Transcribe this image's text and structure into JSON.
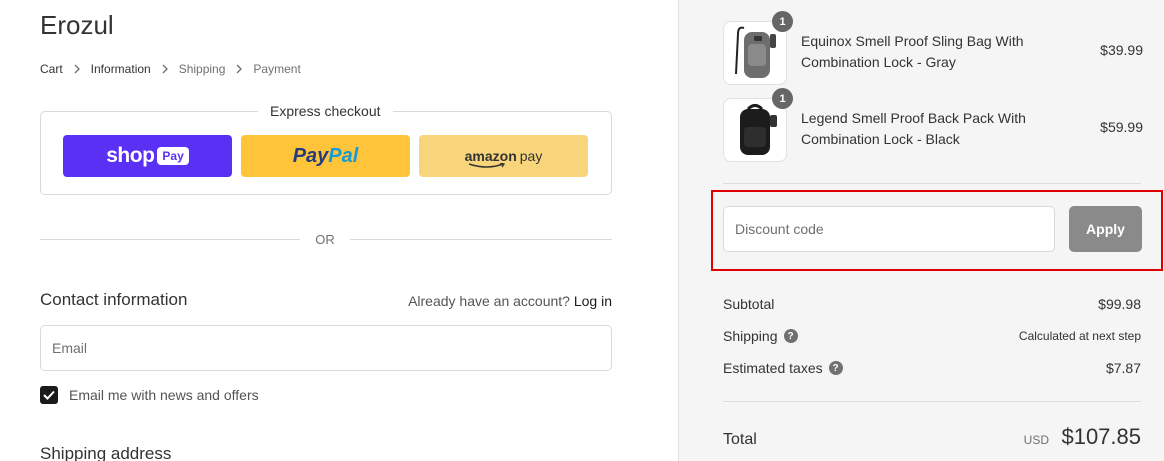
{
  "store": {
    "name": "Erozul"
  },
  "breadcrumb": [
    {
      "label": "Cart"
    },
    {
      "label": "Information"
    },
    {
      "label": "Shipping"
    },
    {
      "label": "Payment"
    }
  ],
  "express": {
    "legend": "Express checkout",
    "shop_pay": {
      "shop": "shop",
      "pay": "Pay",
      "color": "#5a31f4"
    },
    "paypal": {
      "part1": "Pay",
      "part2": "Pal",
      "color": "#ffc439"
    },
    "amazon": {
      "brand": "amazon",
      "pay": "pay",
      "color": "#f8d57a"
    }
  },
  "divider_text": "OR",
  "contact": {
    "heading": "Contact information",
    "account_prompt": "Already have an account?",
    "login_label": "Log in",
    "email_placeholder": "Email",
    "newsletter_label": "Email me with news and offers",
    "newsletter_checked": true
  },
  "shipping": {
    "heading": "Shipping address"
  },
  "cart": {
    "items": [
      {
        "quantity": "1",
        "name": "Equinox Smell Proof Sling Bag With Combination Lock - Gray",
        "price": "$39.99",
        "icon": "sling-bag-gray-icon"
      },
      {
        "quantity": "1",
        "name": "Legend Smell Proof Back Pack With Combination Lock - Black",
        "price": "$59.99",
        "icon": "backpack-black-icon"
      }
    ]
  },
  "discount": {
    "placeholder": "Discount code",
    "apply_label": "Apply",
    "highlight_color": "#e00000"
  },
  "summary": {
    "subtotal_label": "Subtotal",
    "subtotal_value": "$99.98",
    "shipping_label": "Shipping",
    "shipping_value": "Calculated at next step",
    "taxes_label": "Estimated taxes",
    "taxes_value": "$7.87",
    "help_glyph": "?",
    "total_label": "Total",
    "total_currency": "USD",
    "total_value": "$107.85"
  }
}
